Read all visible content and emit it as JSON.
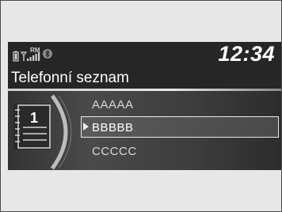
{
  "status": {
    "time": "12:34",
    "signal_label": "RM",
    "icons": [
      "phone-battery-icon",
      "signal-strength-icon",
      "bluetooth-icon"
    ]
  },
  "screen": {
    "title": "Telefonní seznam"
  },
  "phonebook": {
    "icon": "phonebook-icon",
    "page_number": "1",
    "items": [
      {
        "label": "AAAAA"
      },
      {
        "label": "BBBBB",
        "selected": true
      },
      {
        "label": "CCCCC"
      }
    ]
  },
  "colors": {
    "screen_bg": "#262626",
    "text": "#ffffff",
    "selection_border": "#eaeaea"
  }
}
